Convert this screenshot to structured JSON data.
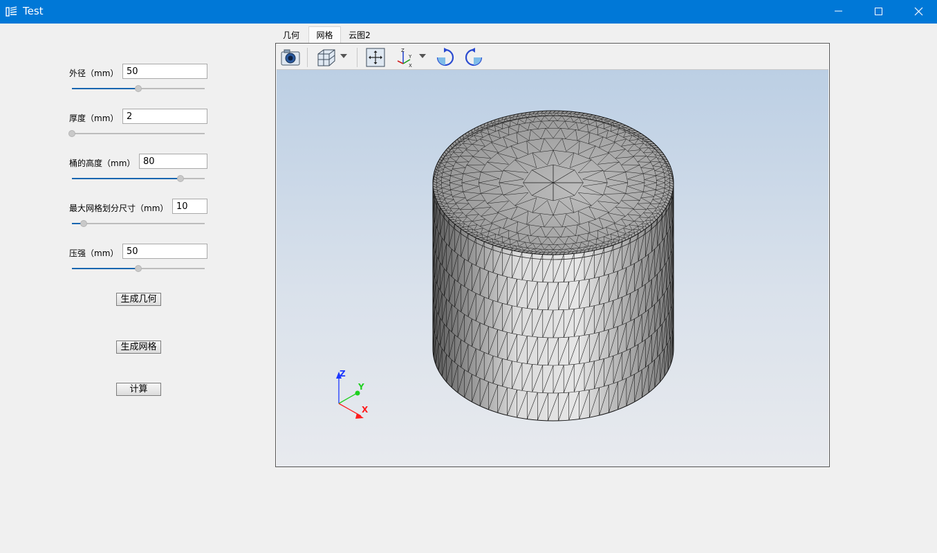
{
  "window": {
    "title": "Test"
  },
  "form": {
    "fields": [
      {
        "label": "外径（mm）",
        "value": "50",
        "level": 0.5
      },
      {
        "label": "厚度（mm）",
        "value": "2",
        "level": 0.0
      },
      {
        "label": "桶的高度（mm）",
        "value": "80",
        "level": 0.82
      },
      {
        "label": "最大网格划分尺寸（mm）",
        "value": "10",
        "level": 0.09
      },
      {
        "label": "压强（mm）",
        "value": "50",
        "level": 0.5
      }
    ],
    "buttons": {
      "generate_geometry": "生成几何",
      "generate_mesh": "生成网格",
      "compute": "计算"
    }
  },
  "tabs": [
    {
      "label": "几何"
    },
    {
      "label": "网格"
    },
    {
      "label": "云图2"
    }
  ],
  "active_tab": 1,
  "toolbar": {
    "icons": [
      "camera-icon",
      "cube-view-icon",
      "fit-view-icon",
      "axes-icon",
      "rotate-cw-icon",
      "rotate-ccw-icon"
    ]
  },
  "axes": {
    "x": "X",
    "y": "Y",
    "z": "Z"
  },
  "colors": {
    "titlebar": "#0078d7",
    "slider_fill": "#1866b0",
    "axis_x": "#e00000",
    "axis_y": "#00c000",
    "axis_z": "#0000e0"
  }
}
